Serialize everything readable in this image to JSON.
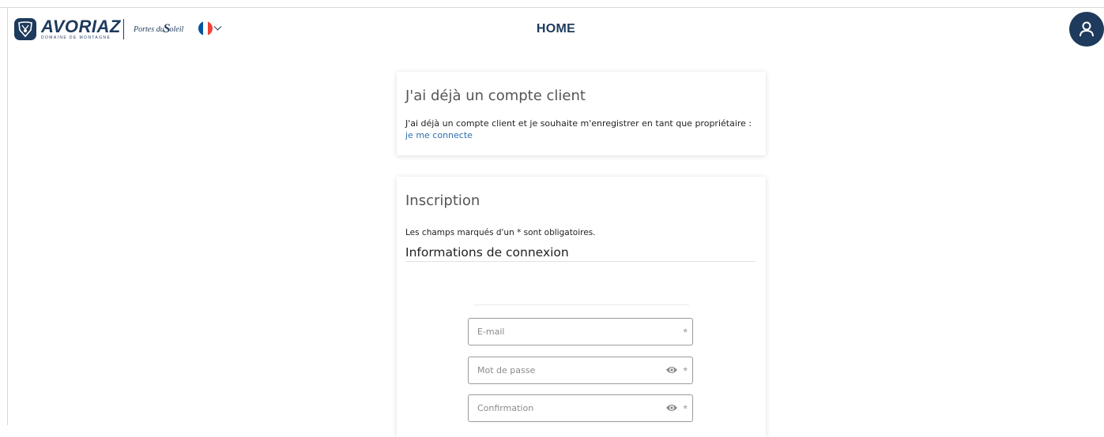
{
  "header": {
    "brand_name": "AVORIAZ",
    "brand_sub": "DOMAINE DE MONTAGNE",
    "partner_logo": {
      "left": "Portes du",
      "big": "S",
      "right": "oleil"
    },
    "language": "fr",
    "title": "HOME"
  },
  "colors": {
    "brand_navy": "#1e3a5c",
    "link": "#2f6fae",
    "flag_blue": "#0055a4",
    "flag_white": "#ffffff",
    "flag_red": "#ef4135"
  },
  "existing_account": {
    "title": "J'ai déjà un compte client",
    "text": "J'ai déjà un compte client et je souhaite m'enregistrer en tant que propriétaire : ",
    "link": "je me connecte"
  },
  "signup": {
    "title": "Inscription",
    "required_note": "Les champs marqués d'un * sont obligatoires.",
    "section_title": "Informations de connexion",
    "fields": [
      {
        "placeholder": "E-mail",
        "required_mark": "*",
        "icon": "none"
      },
      {
        "placeholder": "Mot de passe",
        "required_mark": "*",
        "icon": "eye-icon"
      },
      {
        "placeholder": "Confirmation",
        "required_mark": "*",
        "icon": "eye-icon"
      }
    ]
  }
}
